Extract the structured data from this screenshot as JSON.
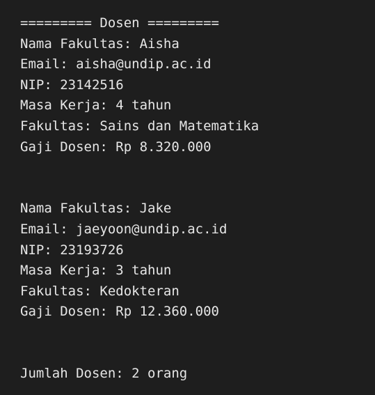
{
  "header": "========= Dosen =========",
  "records": [
    {
      "nama": "Nama Fakultas: Aisha",
      "email": "Email: aisha@undip.ac.id",
      "nip": "NIP: 23142516",
      "masa_kerja": "Masa Kerja: 4 tahun",
      "fakultas": "Fakultas: Sains dan Matematika",
      "gaji": "Gaji Dosen: Rp 8.320.000"
    },
    {
      "nama": "Nama Fakultas: Jake",
      "email": "Email: jaeyoon@undip.ac.id",
      "nip": "NIP: 23193726",
      "masa_kerja": "Masa Kerja: 3 tahun",
      "fakultas": "Fakultas: Kedokteran",
      "gaji": "Gaji Dosen: Rp 12.360.000"
    }
  ],
  "summary": "Jumlah Dosen: 2 orang"
}
